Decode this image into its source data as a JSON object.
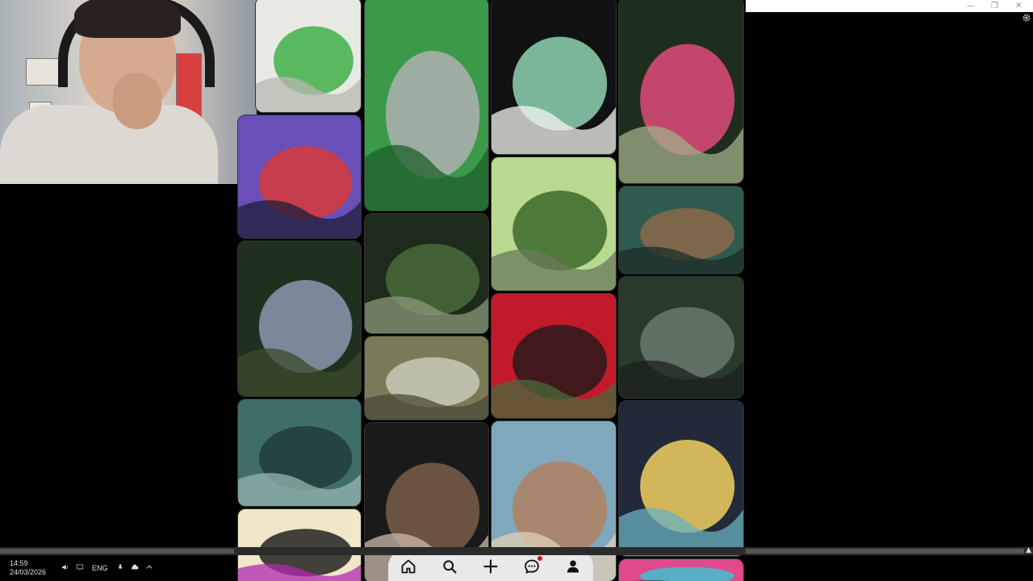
{
  "window": {
    "minimize_glyph": "—",
    "restore_glyph": "❐",
    "close_glyph": "✕",
    "settings_icon": "gear-icon"
  },
  "feed": {
    "pins": [
      {
        "name": "pin-sketch-creature",
        "colors": [
          "#e9e9e4",
          "#3fb04a",
          "#b8b8b0"
        ]
      },
      {
        "name": "pin-wolf-creature",
        "colors": [
          "#6a4fb8",
          "#d63a3a",
          "#1d1d3a"
        ]
      },
      {
        "name": "pin-swamp-moon",
        "colors": [
          "#20301f",
          "#8d96b0",
          "#3b4b2c"
        ]
      },
      {
        "name": "pin-swamp-dock",
        "colors": [
          "#3f6e68",
          "#1f3d3a",
          "#95b5b0"
        ]
      },
      {
        "name": "pin-goat-comic",
        "colors": [
          "#f0e6c8",
          "#222222",
          "#b22ab0"
        ]
      },
      {
        "name": "pin-green-dragon",
        "colors": [
          "#3a9a4a",
          "#b0b0b0",
          "#1f5f2a"
        ]
      },
      {
        "name": "pin-swamp-path",
        "colors": [
          "#1d2b1a",
          "#4a6a3a",
          "#8a9a7a"
        ]
      },
      {
        "name": "pin-swamp-cabin",
        "colors": [
          "#7a7a58",
          "#c9cbb8",
          "#4a4a38"
        ]
      },
      {
        "name": "pin-boots-knife",
        "colors": [
          "#1a1a1a",
          "#7a5e4a",
          "#c9b8a8"
        ]
      },
      {
        "name": "pin-green-bird",
        "colors": [
          "#111111",
          "#8fd4b0",
          "#f4f4f0"
        ]
      },
      {
        "name": "pin-abandoned-rv",
        "colors": [
          "#b9d890",
          "#3a6a2a",
          "#6a7a5a"
        ]
      },
      {
        "name": "pin-red-forest",
        "colors": [
          "#c21a2a",
          "#2a1a1a",
          "#4a6a3a"
        ]
      },
      {
        "name": "pin-bird-man",
        "colors": [
          "#7fa8bd",
          "#b08060",
          "#e0d0b8"
        ]
      },
      {
        "name": "pin-jungle-house",
        "colors": [
          "#1e2e1c",
          "#e04a7a",
          "#a0b08a"
        ]
      },
      {
        "name": "pin-van-painting",
        "colors": [
          "#2f5a50",
          "#8a6a4a",
          "#1c2c28"
        ]
      },
      {
        "name": "pin-boat-forest",
        "colors": [
          "#2a3a2a",
          "#6a7a6a",
          "#1a221a"
        ]
      },
      {
        "name": "pin-angel-car",
        "colors": [
          "#222a3a",
          "#f0d060",
          "#6ab0c0"
        ]
      },
      {
        "name": "pin-colorful-bottom",
        "colors": [
          "#e04a8a",
          "#40c0d0",
          "#1a1a1a"
        ]
      }
    ]
  },
  "bottom_nav": {
    "items": [
      {
        "name": "nav-home",
        "icon": "home-icon"
      },
      {
        "name": "nav-search",
        "icon": "search-icon"
      },
      {
        "name": "nav-create",
        "icon": "plus-icon"
      },
      {
        "name": "nav-messages",
        "icon": "chat-icon",
        "has_notification": true
      },
      {
        "name": "nav-profile",
        "icon": "person-icon"
      }
    ],
    "notification_color": "#e60023"
  },
  "taskbar": {
    "time": "14:59",
    "date": "24/03/2026",
    "language": "ENG",
    "icons": [
      "speaker-icon",
      "display-icon",
      "microphone-icon",
      "cloud-icon",
      "chevron-up-icon"
    ]
  }
}
